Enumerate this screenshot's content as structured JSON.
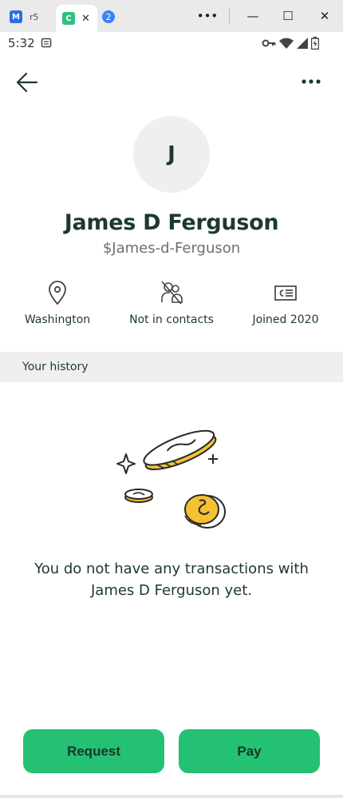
{
  "browser": {
    "tabs": [
      {
        "label": "r5",
        "icon": "m-app-icon",
        "color": "#2a6fe0"
      },
      {
        "label": "",
        "icon": "c-app-icon",
        "color": "#2ec27e",
        "close": "✕"
      },
      {
        "label": "2",
        "icon": "badge-icon",
        "color": "#3b82f6"
      }
    ],
    "window_buttons": {
      "menu": "•••",
      "minimize": "—",
      "maximize": "☐",
      "close": "✕"
    }
  },
  "status_bar": {
    "time": "5:32"
  },
  "profile": {
    "avatar_initial": "J",
    "name": "James D Ferguson",
    "handle": "$James-d-Ferguson",
    "info": [
      {
        "label": "Washington",
        "icon": "location-pin-icon"
      },
      {
        "label": "Not in contacts",
        "icon": "contact-off-icon"
      },
      {
        "label": "Joined 2020",
        "icon": "id-card-icon"
      }
    ]
  },
  "history": {
    "title": "Your history",
    "empty_message": "You do not have any transactions with James D Ferguson yet."
  },
  "actions": {
    "request_label": "Request",
    "pay_label": "Pay"
  },
  "colors": {
    "accent": "#24c073",
    "text_dark": "#1c3a2b",
    "coin_yellow": "#f5c132",
    "section_bg": "#efefef"
  }
}
